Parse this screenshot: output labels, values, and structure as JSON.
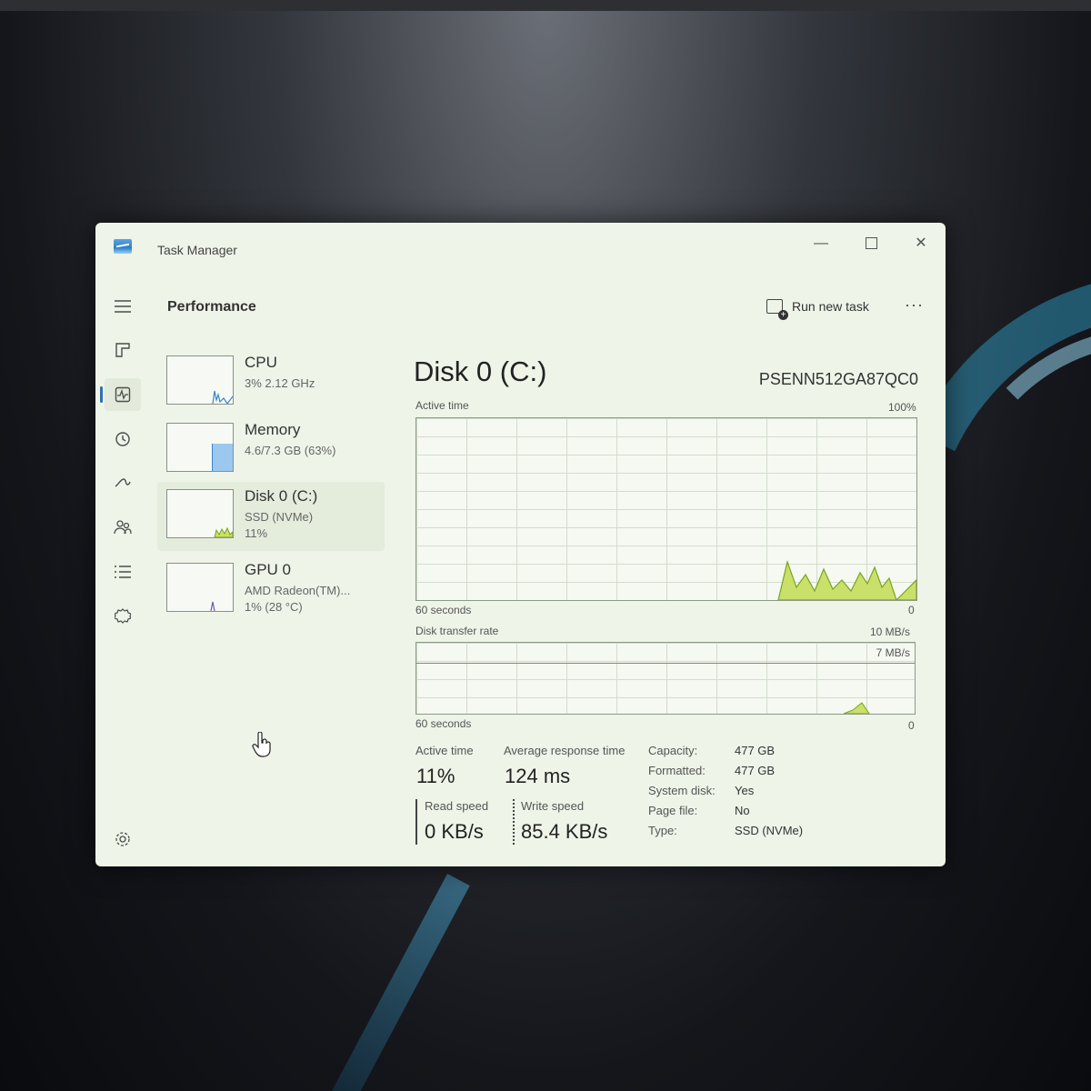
{
  "window": {
    "title": "Task Manager",
    "minimize": "—",
    "close": "✕"
  },
  "header": {
    "pane_title": "Performance",
    "run_new_task": "Run new task",
    "more": "···"
  },
  "rail": {
    "items": [
      "menu-icon",
      "processes-icon",
      "performance-icon",
      "app-history-icon",
      "startup-apps-icon",
      "users-icon",
      "details-icon",
      "services-icon",
      "settings-icon"
    ]
  },
  "resources": [
    {
      "name": "CPU",
      "line1": "3%  2.12 GHz",
      "line2": ""
    },
    {
      "name": "Memory",
      "line1": "4.6/7.3 GB (63%)",
      "line2": ""
    },
    {
      "name": "Disk 0 (C:)",
      "line1": "SSD (NVMe)",
      "line2": "11%"
    },
    {
      "name": "GPU 0",
      "line1": "AMD Radeon(TM)...",
      "line2": "1%  (28 °C)"
    }
  ],
  "detail": {
    "title": "Disk 0 (C:)",
    "model": "PSENN512GA87QC0",
    "active_time_label": "Active time",
    "active_max": "100%",
    "seconds_label_1": "60 seconds",
    "zero_1": "0",
    "transfer_label": "Disk transfer rate",
    "transfer_max": "10 MB/s",
    "transfer_marker": "7 MB/s",
    "seconds_label_2": "60 seconds",
    "zero_2": "0"
  },
  "stats": {
    "active_time_label": "Active time",
    "active_time_value": "11%",
    "avg_response_label": "Average response time",
    "avg_response_value": "124 ms",
    "read_label": "Read speed",
    "read_value": "0 KB/s",
    "write_label": "Write speed",
    "write_value": "85.4 KB/s"
  },
  "properties": [
    {
      "key": "Capacity:",
      "value": "477 GB"
    },
    {
      "key": "Formatted:",
      "value": "477 GB"
    },
    {
      "key": "System disk:",
      "value": "Yes"
    },
    {
      "key": "Page file:",
      "value": "No"
    },
    {
      "key": "Type:",
      "value": "SSD (NVMe)"
    }
  ],
  "colors": {
    "disk_fill": "#c9e06a",
    "disk_stroke": "#7aa51c",
    "memory_fill": "#9cc8ef",
    "cpu_line": "#3a86c8",
    "gpu_line": "#6b55b8"
  }
}
